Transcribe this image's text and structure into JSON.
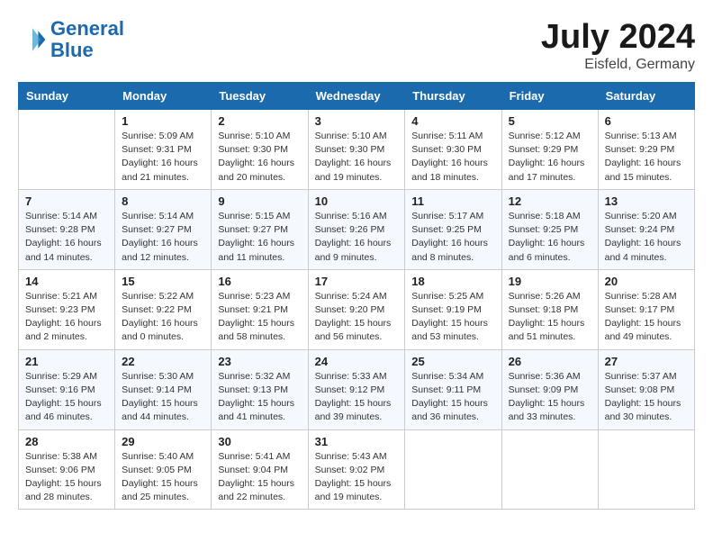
{
  "header": {
    "logo_line1": "General",
    "logo_line2": "Blue",
    "month_title": "July 2024",
    "location": "Eisfeld, Germany"
  },
  "weekdays": [
    "Sunday",
    "Monday",
    "Tuesday",
    "Wednesday",
    "Thursday",
    "Friday",
    "Saturday"
  ],
  "weeks": [
    [
      {
        "day": "",
        "info": ""
      },
      {
        "day": "1",
        "info": "Sunrise: 5:09 AM\nSunset: 9:31 PM\nDaylight: 16 hours\nand 21 minutes."
      },
      {
        "day": "2",
        "info": "Sunrise: 5:10 AM\nSunset: 9:30 PM\nDaylight: 16 hours\nand 20 minutes."
      },
      {
        "day": "3",
        "info": "Sunrise: 5:10 AM\nSunset: 9:30 PM\nDaylight: 16 hours\nand 19 minutes."
      },
      {
        "day": "4",
        "info": "Sunrise: 5:11 AM\nSunset: 9:30 PM\nDaylight: 16 hours\nand 18 minutes."
      },
      {
        "day": "5",
        "info": "Sunrise: 5:12 AM\nSunset: 9:29 PM\nDaylight: 16 hours\nand 17 minutes."
      },
      {
        "day": "6",
        "info": "Sunrise: 5:13 AM\nSunset: 9:29 PM\nDaylight: 16 hours\nand 15 minutes."
      }
    ],
    [
      {
        "day": "7",
        "info": "Sunrise: 5:14 AM\nSunset: 9:28 PM\nDaylight: 16 hours\nand 14 minutes."
      },
      {
        "day": "8",
        "info": "Sunrise: 5:14 AM\nSunset: 9:27 PM\nDaylight: 16 hours\nand 12 minutes."
      },
      {
        "day": "9",
        "info": "Sunrise: 5:15 AM\nSunset: 9:27 PM\nDaylight: 16 hours\nand 11 minutes."
      },
      {
        "day": "10",
        "info": "Sunrise: 5:16 AM\nSunset: 9:26 PM\nDaylight: 16 hours\nand 9 minutes."
      },
      {
        "day": "11",
        "info": "Sunrise: 5:17 AM\nSunset: 9:25 PM\nDaylight: 16 hours\nand 8 minutes."
      },
      {
        "day": "12",
        "info": "Sunrise: 5:18 AM\nSunset: 9:25 PM\nDaylight: 16 hours\nand 6 minutes."
      },
      {
        "day": "13",
        "info": "Sunrise: 5:20 AM\nSunset: 9:24 PM\nDaylight: 16 hours\nand 4 minutes."
      }
    ],
    [
      {
        "day": "14",
        "info": "Sunrise: 5:21 AM\nSunset: 9:23 PM\nDaylight: 16 hours\nand 2 minutes."
      },
      {
        "day": "15",
        "info": "Sunrise: 5:22 AM\nSunset: 9:22 PM\nDaylight: 16 hours\nand 0 minutes."
      },
      {
        "day": "16",
        "info": "Sunrise: 5:23 AM\nSunset: 9:21 PM\nDaylight: 15 hours\nand 58 minutes."
      },
      {
        "day": "17",
        "info": "Sunrise: 5:24 AM\nSunset: 9:20 PM\nDaylight: 15 hours\nand 56 minutes."
      },
      {
        "day": "18",
        "info": "Sunrise: 5:25 AM\nSunset: 9:19 PM\nDaylight: 15 hours\nand 53 minutes."
      },
      {
        "day": "19",
        "info": "Sunrise: 5:26 AM\nSunset: 9:18 PM\nDaylight: 15 hours\nand 51 minutes."
      },
      {
        "day": "20",
        "info": "Sunrise: 5:28 AM\nSunset: 9:17 PM\nDaylight: 15 hours\nand 49 minutes."
      }
    ],
    [
      {
        "day": "21",
        "info": "Sunrise: 5:29 AM\nSunset: 9:16 PM\nDaylight: 15 hours\nand 46 minutes."
      },
      {
        "day": "22",
        "info": "Sunrise: 5:30 AM\nSunset: 9:14 PM\nDaylight: 15 hours\nand 44 minutes."
      },
      {
        "day": "23",
        "info": "Sunrise: 5:32 AM\nSunset: 9:13 PM\nDaylight: 15 hours\nand 41 minutes."
      },
      {
        "day": "24",
        "info": "Sunrise: 5:33 AM\nSunset: 9:12 PM\nDaylight: 15 hours\nand 39 minutes."
      },
      {
        "day": "25",
        "info": "Sunrise: 5:34 AM\nSunset: 9:11 PM\nDaylight: 15 hours\nand 36 minutes."
      },
      {
        "day": "26",
        "info": "Sunrise: 5:36 AM\nSunset: 9:09 PM\nDaylight: 15 hours\nand 33 minutes."
      },
      {
        "day": "27",
        "info": "Sunrise: 5:37 AM\nSunset: 9:08 PM\nDaylight: 15 hours\nand 30 minutes."
      }
    ],
    [
      {
        "day": "28",
        "info": "Sunrise: 5:38 AM\nSunset: 9:06 PM\nDaylight: 15 hours\nand 28 minutes."
      },
      {
        "day": "29",
        "info": "Sunrise: 5:40 AM\nSunset: 9:05 PM\nDaylight: 15 hours\nand 25 minutes."
      },
      {
        "day": "30",
        "info": "Sunrise: 5:41 AM\nSunset: 9:04 PM\nDaylight: 15 hours\nand 22 minutes."
      },
      {
        "day": "31",
        "info": "Sunrise: 5:43 AM\nSunset: 9:02 PM\nDaylight: 15 hours\nand 19 minutes."
      },
      {
        "day": "",
        "info": ""
      },
      {
        "day": "",
        "info": ""
      },
      {
        "day": "",
        "info": ""
      }
    ]
  ]
}
